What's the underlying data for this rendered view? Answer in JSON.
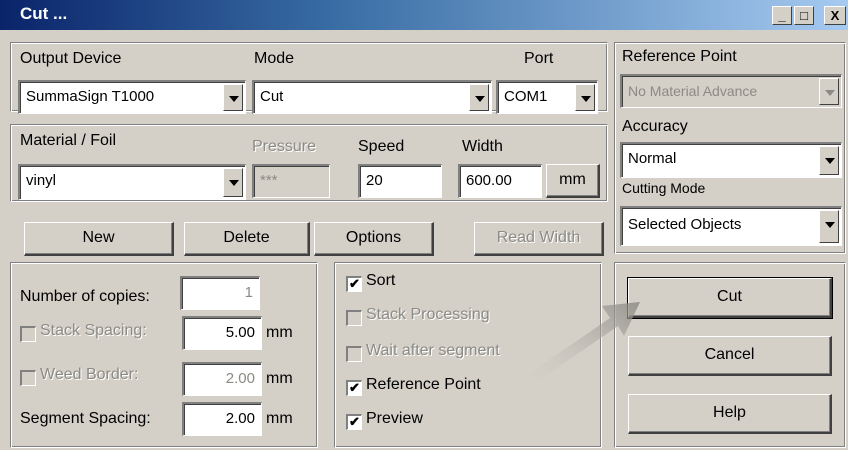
{
  "window": {
    "title": "Cut ...",
    "minimize": "_",
    "maximize": "□",
    "close": "X"
  },
  "output": {
    "device_label": "Output Device",
    "device_value": "SummaSign T1000",
    "mode_label": "Mode",
    "mode_value": "Cut",
    "port_label": "Port",
    "port_value": "COM1"
  },
  "material": {
    "foil_label": "Material / Foil",
    "foil_value": "vinyl",
    "pressure_label": "Pressure",
    "pressure_value": "***",
    "speed_label": "Speed",
    "speed_value": "20",
    "width_label": "Width",
    "width_value": "600.00",
    "width_unit": "mm"
  },
  "actions": {
    "new": "New",
    "delete": "Delete",
    "options": "Options",
    "read_width": "Read Width"
  },
  "settings": {
    "copies_label": "Number of copies:",
    "copies_value": "1",
    "stack_label": "Stack Spacing:",
    "stack_value": "5.00",
    "stack_unit": "mm",
    "weed_label": "Weed Border:",
    "weed_value": "2.00",
    "weed_unit": "mm",
    "segment_label": "Segment Spacing:",
    "segment_value": "2.00",
    "segment_unit": "mm"
  },
  "options": {
    "sort": "Sort",
    "stack_processing": "Stack Processing",
    "wait_segment": "Wait after segment",
    "reference_point": "Reference Point",
    "preview": "Preview"
  },
  "right": {
    "ref_label": "Reference Point",
    "ref_value": "No Material Advance",
    "accuracy_label": "Accuracy",
    "accuracy_value": "Normal",
    "cutting_mode_label": "Cutting Mode",
    "cutting_mode_value": "Selected Objects",
    "cut": "Cut",
    "cancel": "Cancel",
    "help": "Help"
  }
}
